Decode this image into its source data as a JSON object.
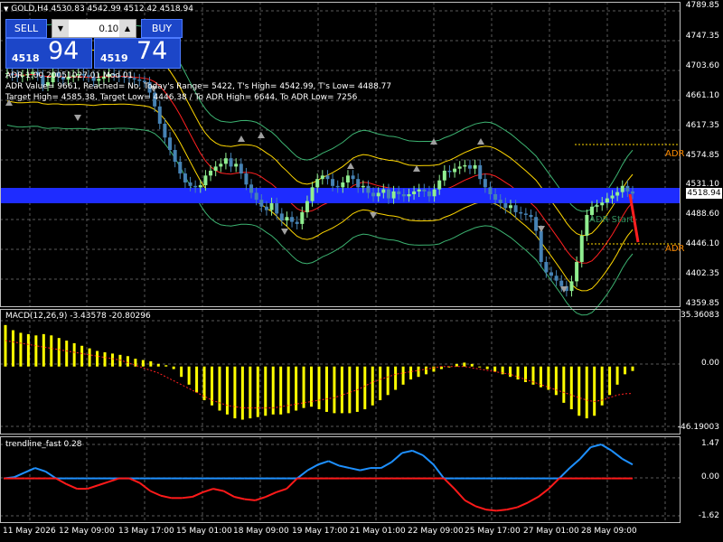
{
  "window": {
    "symbol_title": "GOLD,H4  4530.83 4542.99 4512.42 4518.94"
  },
  "trade_panel": {
    "sell_label": "SELL",
    "buy_label": "BUY",
    "volume_value": "0.10",
    "sell_price_small": "4518",
    "sell_price_big": "94",
    "buy_price_small": "4519",
    "buy_price_big": "74"
  },
  "adr_info": {
    "line1": "ADR 1.00 20051027 01 Mod 01",
    "line2": "ADR Value= 9661, Reached= No, Today's Range= 5422, T's High= 4542.99, T's Low= 4488.77",
    "line3": "Target High= 4585.38, Target Low= 4446.38 / To ADR High= 6644, To ADR Low= 7256",
    "adr_high_label": "ADR",
    "adr_low_label": "ADR",
    "adr_start_label": "ADR Start"
  },
  "price_axis": {
    "ticks": [
      "4789.85",
      "4747.35",
      "4703.60",
      "4661.10",
      "4617.35",
      "4574.85",
      "4531.10",
      "4488.60",
      "4446.10",
      "4402.35",
      "4359.85"
    ],
    "current_price": "4518.94"
  },
  "macd": {
    "label": "MACD(12,26,9) -3.43578 -20.80296",
    "ticks": [
      "35.36083",
      "0.00",
      "-46.19003"
    ]
  },
  "trendline": {
    "label": "trendline_fast 0.28",
    "ticks": [
      "1.47",
      "0.00",
      "-1.62"
    ]
  },
  "time_axis": [
    "11 May 2026",
    "12 May 09:00",
    "13 May 17:00",
    "15 May 01:00",
    "18 May 09:00",
    "19 May 17:00",
    "21 May 01:00",
    "22 May 09:00",
    "25 May 17:00",
    "27 May 01:00",
    "28 May 09:00"
  ],
  "colors": {
    "background": "#000000",
    "grid": "#5a5a5a",
    "bull_candle": "#90ee90",
    "bear_candle": "#4682b4",
    "macd_hist": "#ffff00",
    "macd_signal": "#ff2020",
    "envelope_outer": "#3cb371",
    "envelope_mid": "#ffd700",
    "ma_red": "#ff2020",
    "band_blue": "#1e2cff",
    "trend_blue": "#1e90ff",
    "trend_red": "#ff1a1a",
    "adr_label": "#ff8c00"
  },
  "chart_data": [
    {
      "type": "candlestick",
      "title": "GOLD,H4",
      "ylim": [
        4359.85,
        4789.85
      ],
      "close": [
        4693,
        4690,
        4688,
        4690,
        4692,
        4695,
        4690,
        4675,
        4680,
        4694,
        4688,
        4684,
        4688,
        4690,
        4692,
        4690,
        4688,
        4682,
        4685,
        4688,
        4692,
        4690,
        4688,
        4687,
        4686,
        4684,
        4682,
        4680,
        4665,
        4645,
        4620,
        4600,
        4582,
        4565,
        4548,
        4535,
        4530,
        4528,
        4531,
        4545,
        4552,
        4558,
        4562,
        4570,
        4558,
        4562,
        4548,
        4532,
        4520,
        4510,
        4500,
        4495,
        4505,
        4490,
        4480,
        4485,
        4478,
        4475,
        4492,
        4508,
        4528,
        4540,
        4545,
        4540,
        4530,
        4528,
        4535,
        4545,
        4540,
        4528,
        4530,
        4520,
        4515,
        4520,
        4525,
        4512,
        4522,
        4518,
        4515,
        4518,
        4522,
        4525,
        4522,
        4515,
        4525,
        4538,
        4552,
        4550,
        4555,
        4558,
        4560,
        4555,
        4560,
        4540,
        4528,
        4518,
        4510,
        4505,
        4498,
        4502,
        4492,
        4490,
        4488,
        4485,
        4465,
        4420,
        4405,
        4400,
        4393,
        4385,
        4378,
        4392,
        4420,
        4458,
        4488,
        4500,
        4502,
        4506,
        4512,
        4516,
        4521,
        4530,
        4522,
        4518.94
      ]
    },
    {
      "type": "bar",
      "title": "MACD(12,26,9)",
      "values": [
        32,
        28,
        26,
        25,
        24,
        25,
        24,
        22,
        20,
        18,
        16,
        14,
        12,
        11,
        10,
        9,
        8,
        6,
        5,
        4,
        2,
        1,
        -2,
        -8,
        -14,
        -20,
        -26,
        -30,
        -34,
        -37,
        -40,
        -41,
        -40,
        -39,
        -38,
        -37,
        -37,
        -36,
        -34,
        -32,
        -31,
        -33,
        -35,
        -36,
        -36,
        -36,
        -35,
        -33,
        -30,
        -26,
        -22,
        -18,
        -14,
        -10,
        -8,
        -6,
        -4,
        -2,
        0,
        2,
        3,
        2,
        0,
        -2,
        -4,
        -6,
        -8,
        -10,
        -12,
        -14,
        -16,
        -18,
        -22,
        -28,
        -33,
        -38,
        -40,
        -38,
        -30,
        -22,
        -14,
        -6,
        -3.44
      ],
      "signal": [
        20,
        19,
        18,
        17,
        16,
        15,
        14,
        13,
        12,
        11,
        10,
        9,
        8,
        7,
        6,
        5,
        3,
        1,
        -1,
        -3,
        -5,
        -8,
        -11,
        -14,
        -17,
        -20,
        -23,
        -26,
        -28,
        -30,
        -31,
        -32,
        -32,
        -32,
        -32,
        -32,
        -31,
        -30,
        -29,
        -28,
        -27,
        -26,
        -25,
        -24,
        -22,
        -20,
        -18,
        -15,
        -12,
        -10,
        -8,
        -6,
        -5,
        -4,
        -3,
        -2,
        -1,
        0,
        0,
        0,
        0,
        -1,
        -2,
        -3,
        -4,
        -5,
        -6,
        -8,
        -10,
        -12,
        -14,
        -16,
        -18,
        -20,
        -22,
        -24,
        -26,
        -27,
        -26,
        -24,
        -22,
        -21,
        -20.8
      ],
      "ylim": [
        -46.19003,
        35.36083
      ]
    },
    {
      "type": "line",
      "title": "trendline_fast",
      "series": [
        {
          "name": "trendline_fast",
          "values": [
            0.0,
            0.05,
            0.25,
            0.45,
            0.3,
            0.0,
            -0.25,
            -0.45,
            -0.45,
            -0.3,
            -0.15,
            0.0,
            0.0,
            -0.2,
            -0.55,
            -0.75,
            -0.85,
            -0.85,
            -0.8,
            -0.6,
            -0.45,
            -0.55,
            -0.8,
            -0.9,
            -0.95,
            -0.8,
            -0.6,
            -0.45,
            0.0,
            0.35,
            0.6,
            0.75,
            0.55,
            0.45,
            0.35,
            0.45,
            0.45,
            0.7,
            1.1,
            1.2,
            1.0,
            0.6,
            0.0,
            -0.45,
            -0.95,
            -1.2,
            -1.35,
            -1.4,
            -1.35,
            -1.25,
            -1.05,
            -0.8,
            -0.45,
            0.0,
            0.45,
            0.85,
            1.35,
            1.47,
            1.2,
            0.85,
            0.6
          ]
        }
      ],
      "ylim": [
        -1.62,
        1.47
      ]
    }
  ]
}
